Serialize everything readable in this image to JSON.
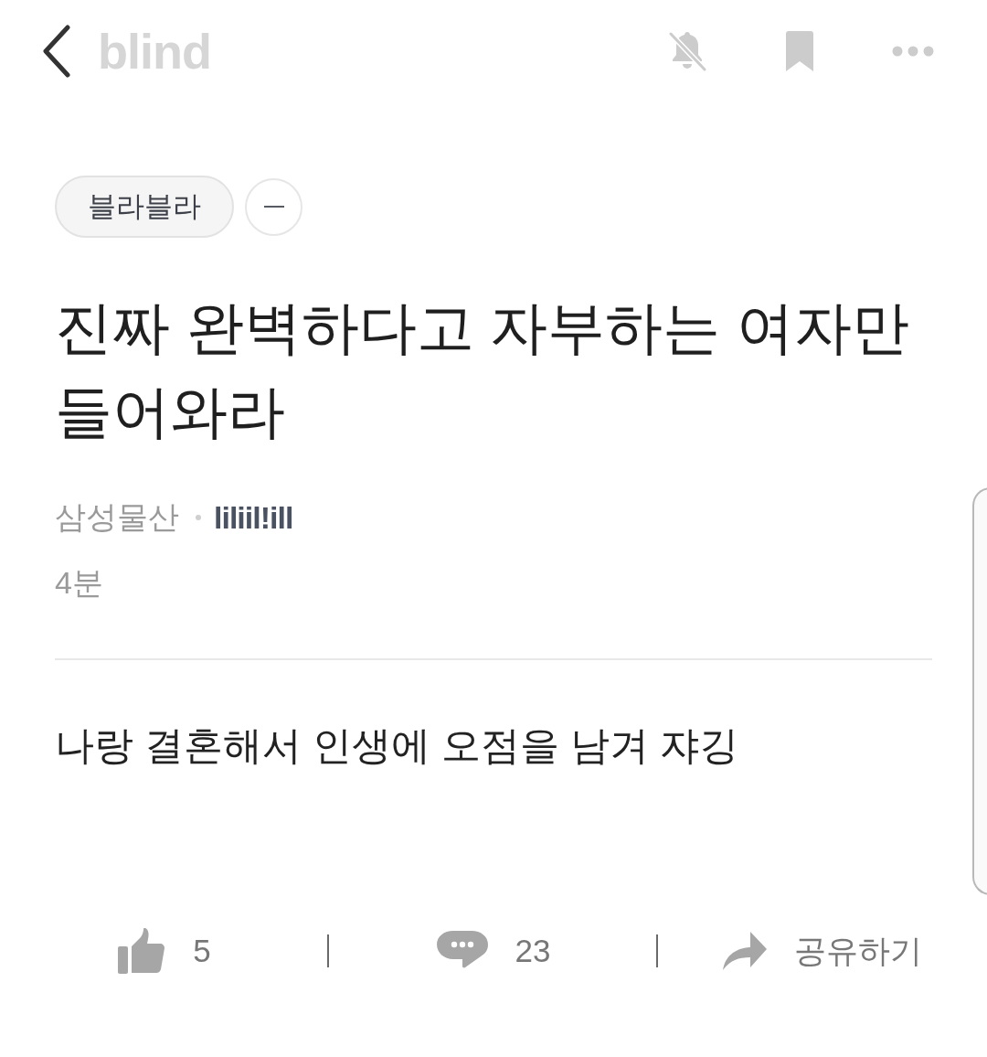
{
  "header": {
    "logo": "blind",
    "notifications_muted": true
  },
  "tag": {
    "label": "블라블라"
  },
  "title": "진짜 완벽하다고 자부하는 여자만 들어와라",
  "author": {
    "company": "삼성물산",
    "nickname": "liliil!ill"
  },
  "time": "4분",
  "body": "나랑 결혼해서 인생에 오점을 남겨 쟈깅",
  "actions": [
    {
      "kind": "like",
      "label": "5"
    },
    {
      "kind": "comment",
      "label": "23"
    },
    {
      "kind": "share",
      "label": "공유하기"
    }
  ]
}
